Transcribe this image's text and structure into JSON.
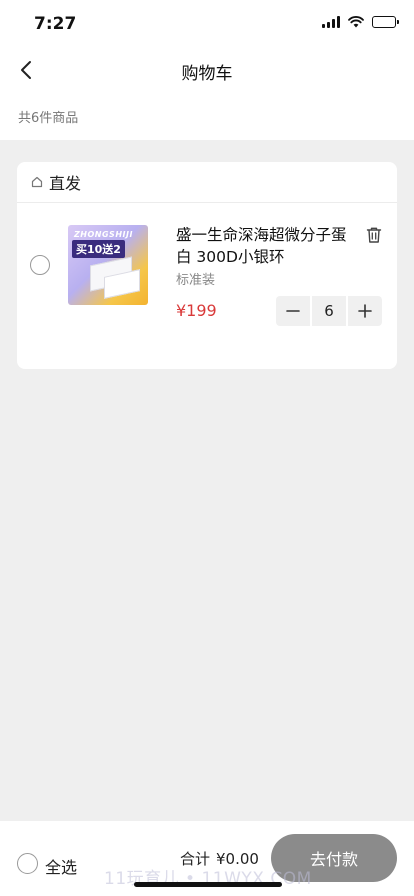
{
  "status_bar": {
    "time": "7:27",
    "icons": [
      "signal-icon",
      "wifi-icon",
      "battery-icon"
    ]
  },
  "nav": {
    "title": "购物车",
    "back_icon": "chevron-left-icon"
  },
  "summary": {
    "count_text": "共6件商品"
  },
  "shop": {
    "icon": "home-icon",
    "name": "直发",
    "items": [
      {
        "title": "盛一生命深海超微分子蛋白 300D小银环",
        "spec": "标准装",
        "price": "¥199",
        "quantity": "6",
        "thumbnail": {
          "brand_text": "ZHONGSHIJI",
          "promo_text": "买10送2"
        },
        "selected": false
      }
    ]
  },
  "footer": {
    "select_all_label": "全选",
    "total_label": "合计",
    "total_value": "¥0.00",
    "checkout_label": "去付款",
    "watermark": "11玩育儿 • 11WYX.COM"
  },
  "colors": {
    "price_red": "#d93a3a",
    "checkout_gray": "#8b8b8b",
    "background": "#efefef"
  }
}
